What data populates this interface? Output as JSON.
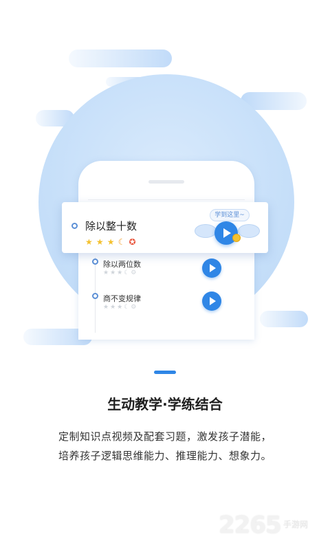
{
  "illustration": {
    "card": {
      "title": "除以整十数",
      "stars_filled": 3,
      "bubble_label": "学到这里~"
    },
    "list_items": [
      {
        "label": "除以两位数"
      },
      {
        "label": "商不变规律"
      }
    ]
  },
  "page_indicator": {
    "active_index": 0
  },
  "headline": "生动教学·学练结合",
  "description": {
    "line1": "定制知识点视频及配套习题，激发孩子潜能，",
    "line2": "培养孩子逻辑思维能力、推理能力、想象力。"
  },
  "watermark": {
    "number": "2265",
    "text": "手游网"
  },
  "colors": {
    "accent": "#2f86e6",
    "circle": "#c6dff9",
    "star": "#f4c12f"
  }
}
